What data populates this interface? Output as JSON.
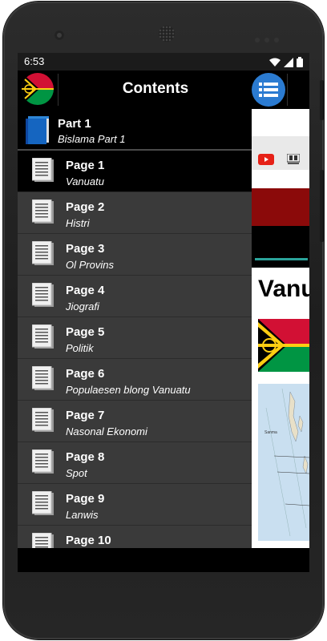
{
  "status_bar": {
    "time": "6:53",
    "icons": [
      "wifi-icon",
      "signal-icon",
      "battery-icon"
    ]
  },
  "toolbar": {
    "title": "Contents",
    "logo": "vanuatu-flag-icon",
    "menu_icon": "list-menu-icon",
    "menu_color": "#2b7bd1"
  },
  "drawer": {
    "part": {
      "title": "Part 1",
      "subtitle": "Bislama Part 1",
      "icon": "book-icon"
    },
    "pages": [
      {
        "title": "Page 1",
        "subtitle": "Vanuatu",
        "active": true
      },
      {
        "title": "Page 2",
        "subtitle": "Histri"
      },
      {
        "title": "Page 3",
        "subtitle": "Ol Provins"
      },
      {
        "title": "Page 4",
        "subtitle": "Jiografi"
      },
      {
        "title": "Page 5",
        "subtitle": "Politik"
      },
      {
        "title": "Page 6",
        "subtitle": "Populaesen blong Vanuatu"
      },
      {
        "title": "Page 7",
        "subtitle": "Nasonal Ekonomi"
      },
      {
        "title": "Page 8",
        "subtitle": "Spot"
      },
      {
        "title": "Page 9",
        "subtitle": "Lanwis"
      },
      {
        "title": "Page 10",
        "subtitle": ""
      }
    ]
  },
  "webpage": {
    "heading": "Vanu",
    "map_labels": [
      "Sanma"
    ]
  },
  "colors": {
    "drawer_bg": "#3a3a3a",
    "active_row": "#000000",
    "web_banner_red": "#8b0a0a",
    "web_accent_teal": "#2aa39a"
  }
}
